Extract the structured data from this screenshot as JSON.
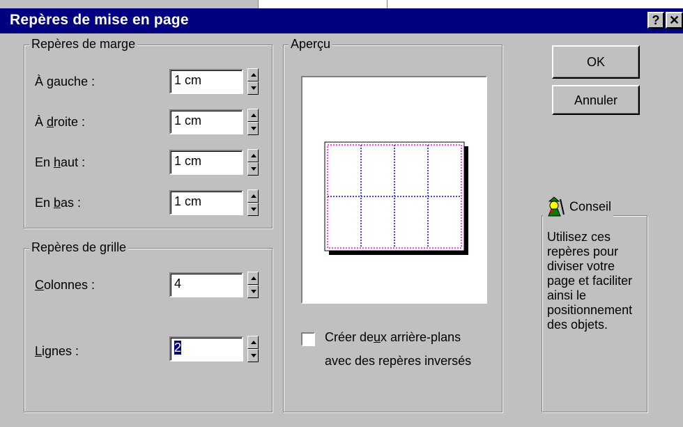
{
  "window": {
    "title": "Repères de mise en page",
    "help_glyph": "?",
    "close_glyph": "✕"
  },
  "margin_group": {
    "label": "Repères de marge",
    "left": {
      "pre": "À ",
      "key": "g",
      "post": "auche :",
      "value": "1 cm"
    },
    "right": {
      "pre": "À ",
      "key": "d",
      "post": "roite :",
      "value": "1 cm"
    },
    "top": {
      "pre": "En ",
      "key": "h",
      "post": "aut :",
      "value": "1 cm"
    },
    "bottom": {
      "pre": "En ",
      "key": "b",
      "post": "as :",
      "value": "1 cm"
    }
  },
  "grid_group": {
    "label": "Repères de grille",
    "columns": {
      "pre": "",
      "key": "C",
      "post": "olonnes :",
      "value": "4"
    },
    "rows": {
      "pre": "",
      "key": "L",
      "post": "ignes :",
      "value": "2"
    }
  },
  "preview": {
    "label": "Aperçu",
    "columns": 4,
    "rows": 2,
    "margin_color": "#ff00ff",
    "grid_color": "#0000ff"
  },
  "mirror_option": {
    "line1_pre": "Créer de",
    "line1_key": "u",
    "line1_post": "x arrière-plans",
    "line2": "avec des repères inversés",
    "checked": false
  },
  "buttons": {
    "ok": "OK",
    "cancel": "Annuler"
  },
  "tip": {
    "label": "Conseil",
    "icon": "wizard-icon",
    "lines": [
      "Utilisez ces",
      "repères pour",
      "diviser votre",
      "page et faciliter",
      "ainsi le",
      "positionnement",
      "des objets."
    ]
  },
  "colors": {
    "titlebar": "#000080",
    "face": "#c0c0c0",
    "selection": "#000080"
  }
}
